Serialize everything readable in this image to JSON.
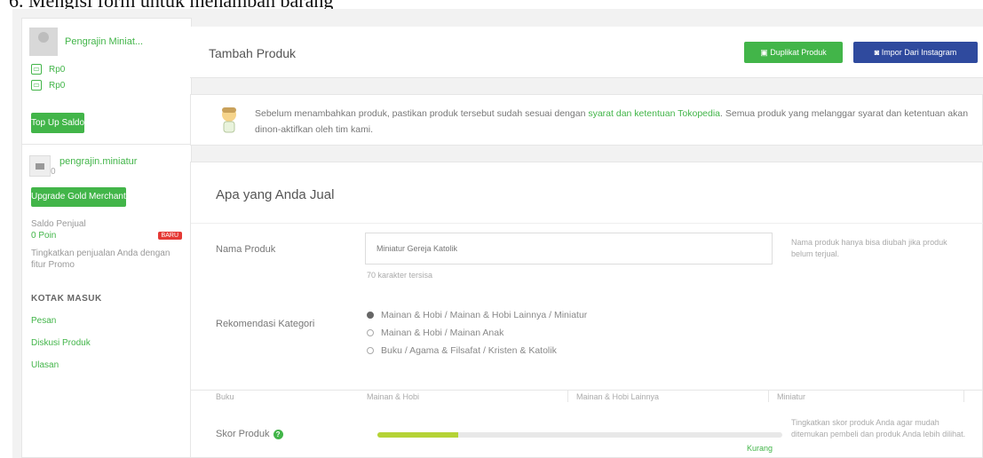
{
  "caption": "6.   Mengisi form untuk menambah barang",
  "sidebar": {
    "profile_name": "Pengrajin Miniat...",
    "links": [
      {
        "icon": "wallet-icon",
        "label": "Rp0"
      },
      {
        "icon": "wallet-icon",
        "label": "Rp0"
      }
    ],
    "topup_label": "Top Up Saldo",
    "shop_name": "pengrajin.miniatur",
    "shop_sub": "0",
    "gold_label": "Upgrade Gold Merchant",
    "saldo_label": "Saldo Penjual",
    "saldo_value": "0 Poin",
    "saldo_badge": "BARU",
    "promo_text": "Tingkatkan penjualan Anda dengan fitur Promo",
    "kotak_masuk": "KOTAK MASUK",
    "items": [
      "Pesan",
      "Diskusi Produk",
      "Ulasan"
    ]
  },
  "header": {
    "title": "Tambah Produk",
    "duplicate_label": "Duplikat Produk",
    "instagram_label": "Impor Dari Instagram"
  },
  "notice": {
    "text_before": "Sebelum menambahkan produk, pastikan produk tersebut sudah sesuai dengan ",
    "link": "syarat dan ketentuan Tokopedia",
    "text_after": ". Semua produk yang melanggar syarat dan ketentuan akan dinon-aktifkan oleh tim kami."
  },
  "form": {
    "section_title": "Apa yang Anda Jual",
    "name_label": "Nama Produk",
    "name_value": "Miniatur Gereja Katolik",
    "name_counter": "70 karakter tersisa",
    "name_hint": "Nama produk hanya bisa diubah jika produk belum terjual.",
    "category_label": "Rekomendasi Kategori",
    "categories": [
      {
        "label": "Mainan & Hobi / Mainan & Hobi Lainnya / Miniatur",
        "selected": true
      },
      {
        "label": "Mainan & Hobi / Mainan Anak",
        "selected": false
      },
      {
        "label": "Buku / Agama & Filsafat / Kristen & Katolik",
        "selected": false
      }
    ],
    "table_headers": [
      "Buku",
      "Mainan & Hobi",
      "Mainan & Hobi Lainnya",
      "Miniatur"
    ],
    "score_label": "Skor Produk",
    "score_value": 0.2,
    "score_caption": "Kurang",
    "score_hint": "Tingkatkan skor produk Anda agar mudah ditemukan pembeli dan produk Anda lebih dilihat."
  },
  "colors": {
    "accent": "#42b549",
    "instagram": "#2f4a9e",
    "score": "#b5d335"
  }
}
